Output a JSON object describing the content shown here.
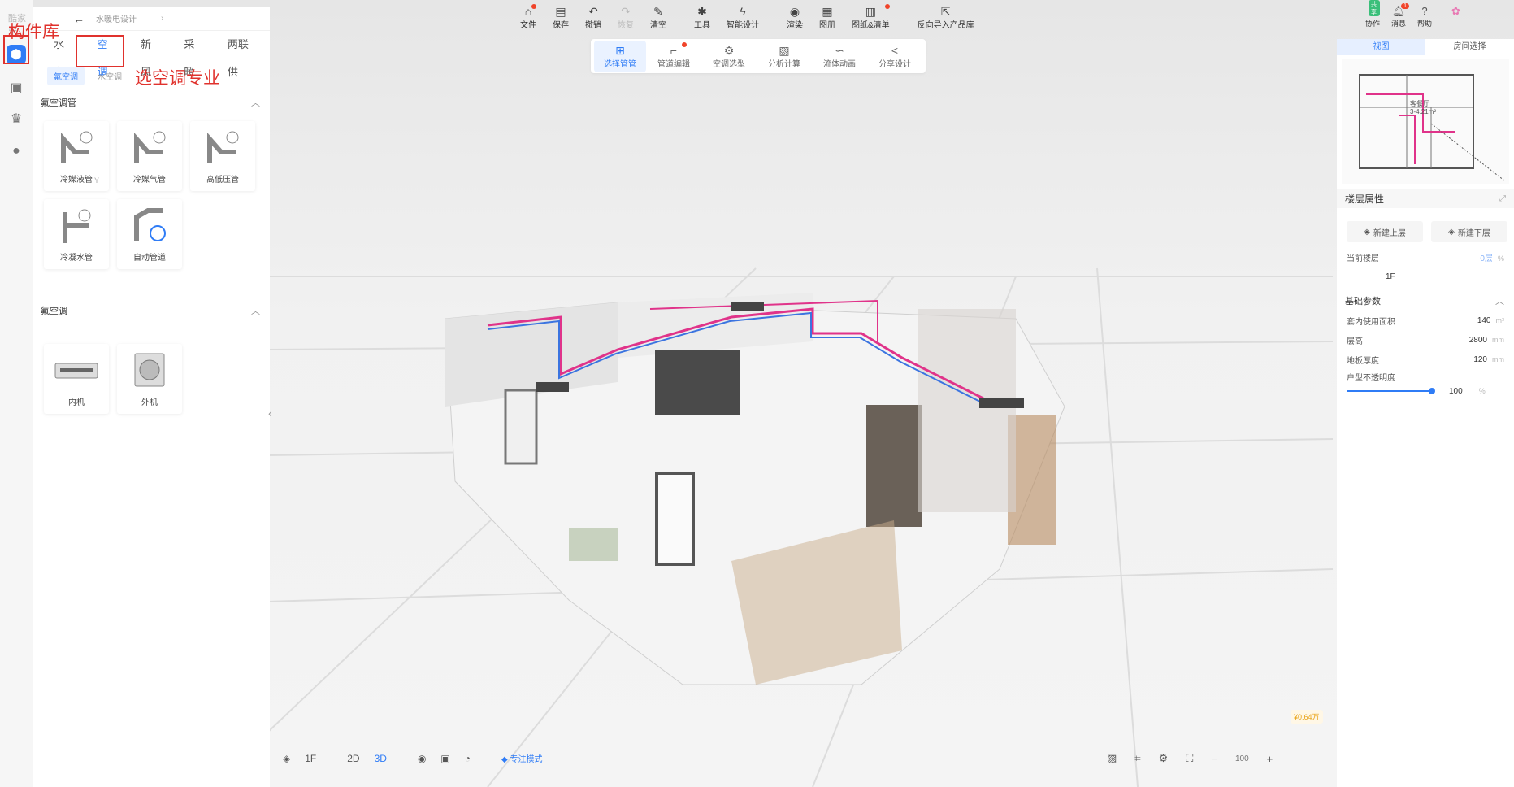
{
  "app": {
    "logo_text": "酷家乐",
    "breadcrumb": "水暖电设计"
  },
  "toolbar": [
    {
      "label": "文件",
      "icon": "house-icon",
      "dot": true
    },
    {
      "label": "保存",
      "icon": "save-icon"
    },
    {
      "label": "撤销",
      "icon": "undo-icon"
    },
    {
      "label": "恢复",
      "icon": "redo-icon",
      "disabled": true
    },
    {
      "label": "清空",
      "icon": "eraser-icon"
    },
    {
      "label": "工具",
      "icon": "wrench-icon"
    },
    {
      "label": "智能设计",
      "icon": "lightning-icon"
    },
    {
      "label": "渲染",
      "icon": "camera-icon"
    },
    {
      "label": "图册",
      "icon": "album-icon"
    },
    {
      "label": "图纸&清单",
      "icon": "document-icon",
      "dot": true
    },
    {
      "label": "反向导入产品库",
      "icon": "import-icon"
    }
  ],
  "subbar": [
    {
      "label": "选择管管",
      "icon": "select-pipe-icon",
      "active": true
    },
    {
      "label": "管道编辑",
      "icon": "pipe-edit-icon",
      "dot": true
    },
    {
      "label": "空调选型",
      "icon": "ac-select-icon"
    },
    {
      "label": "分析计算",
      "icon": "analysis-icon"
    },
    {
      "label": "流体动画",
      "icon": "flow-icon"
    },
    {
      "label": "分享设计",
      "icon": "share-icon"
    }
  ],
  "left_panel": {
    "tabs": [
      "水电",
      "空调",
      "新风",
      "采暖",
      "两联供"
    ],
    "active_tab": "空调",
    "subtabs": [
      "氟空调",
      "水空调"
    ],
    "active_subtab": "氟空调",
    "sections": [
      {
        "title": "氟空调管",
        "items": [
          {
            "label": "冷媒液管",
            "tag": "Y"
          },
          {
            "label": "冷媒气管"
          },
          {
            "label": "高低压管"
          },
          {
            "label": "冷凝水管"
          },
          {
            "label": "自动管道"
          }
        ]
      },
      {
        "title": "氟空调",
        "items": [
          {
            "label": "内机"
          },
          {
            "label": "外机"
          }
        ]
      }
    ]
  },
  "annotations": {
    "component_lib": "构件库",
    "select_ac": "选空调专业"
  },
  "top_right": [
    {
      "label": "协作",
      "icon": "collab-icon",
      "green_badge": "共享"
    },
    {
      "label": "消息",
      "icon": "bell-icon",
      "badge": "1"
    },
    {
      "label": "帮助",
      "icon": "help-icon"
    }
  ],
  "right_panel": {
    "tabs": [
      "视图",
      "房间选择"
    ],
    "active_tab": "视图",
    "minimap_label": "客餐厅",
    "minimap_area": "3-4.21m²",
    "title": "楼层属性",
    "buttons": [
      "新建上层",
      "新建下层"
    ],
    "current_floor_label": "当前楼层",
    "current_floor_value": "1F",
    "current_floor_extra": "0层",
    "current_floor_unit": "%",
    "basic_params_title": "基础参数",
    "params": [
      {
        "label": "套内使用面积",
        "value": "140",
        "unit": "m²"
      },
      {
        "label": "层高",
        "value": "2800",
        "unit": "mm"
      },
      {
        "label": "地板厚度",
        "value": "120",
        "unit": "mm"
      }
    ],
    "opacity_label": "户型不透明度",
    "opacity_value": "100",
    "opacity_unit": "%"
  },
  "bottom": {
    "floor": "1F",
    "view2d": "2D",
    "view3d": "3D",
    "focus_mode": "专注模式",
    "zoom": "100",
    "price": "¥0.64万"
  },
  "colors": {
    "accent": "#2f7cf6",
    "annotation": "#e0322d",
    "pipe_pink": "#e0338a",
    "pipe_blue": "#3b74e0"
  }
}
